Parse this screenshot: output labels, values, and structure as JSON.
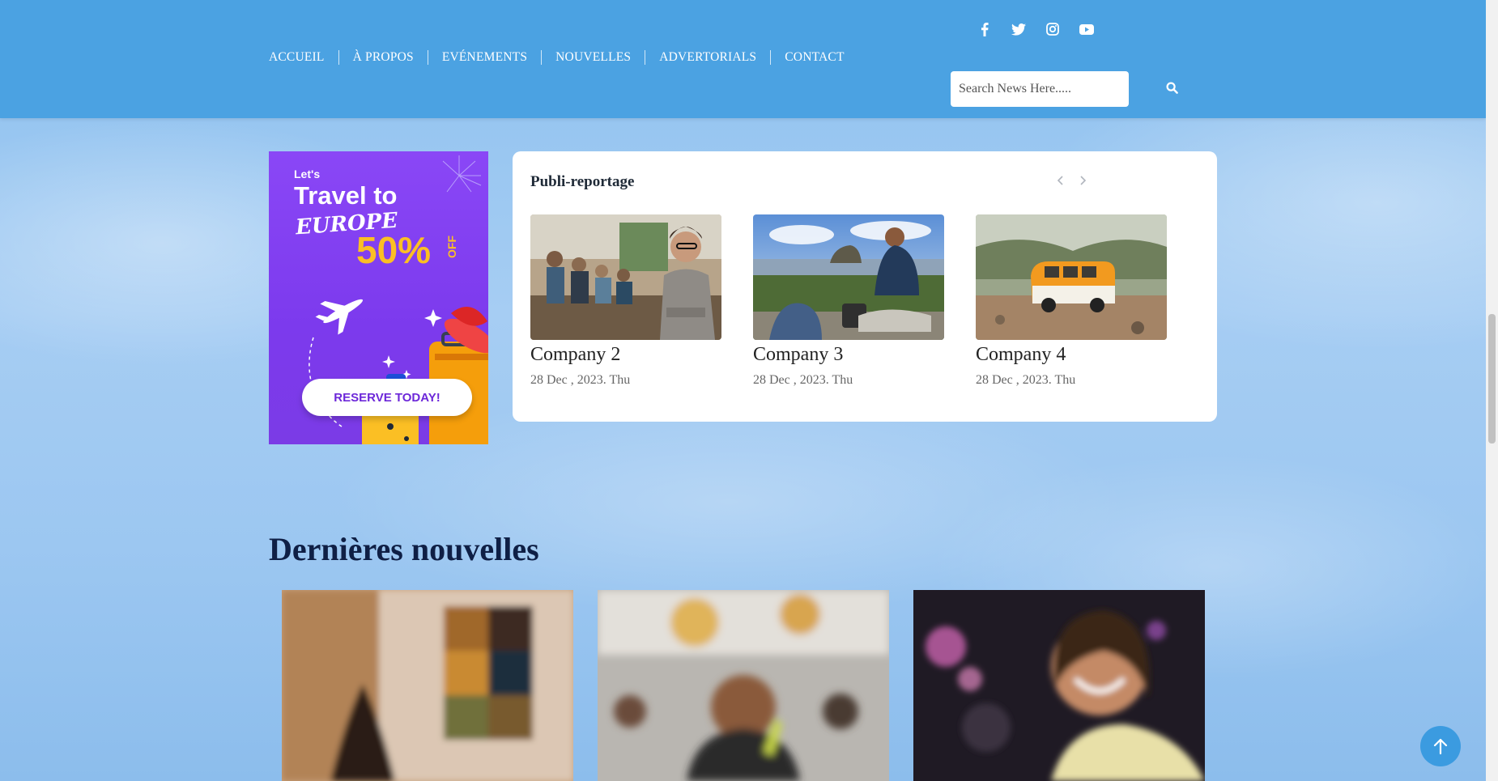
{
  "nav": {
    "items": [
      {
        "label": "ACCUEIL"
      },
      {
        "label": "À PROPOS"
      },
      {
        "label": "EVÉNEMENTS"
      },
      {
        "label": "NOUVELLES"
      },
      {
        "label": "ADVERTORIALS"
      },
      {
        "label": "CONTACT"
      }
    ]
  },
  "socials": [
    "facebook-icon",
    "twitter-icon",
    "instagram-icon",
    "youtube-icon"
  ],
  "search": {
    "placeholder": "Search News Here.....",
    "value": ""
  },
  "ad": {
    "lets": "Let's",
    "travel": "Travel to",
    "europe": "EUROPE",
    "discount": "50%",
    "off": "OFF",
    "cta": "RESERVE TODAY!"
  },
  "publi": {
    "title": "Publi-reportage",
    "cards": [
      {
        "title": "Company 2",
        "date": "28 Dec , 2023. Thu"
      },
      {
        "title": "Company 3",
        "date": "28 Dec , 2023. Thu"
      },
      {
        "title": "Company 4",
        "date": "28 Dec , 2023. Thu"
      }
    ]
  },
  "latest": {
    "title": "Dernières nouvelles"
  },
  "colors": {
    "header": "#4ba2e2",
    "accent": "#3b9be0",
    "ad_purple": "#7c3aed",
    "heading": "#0f1f45"
  }
}
